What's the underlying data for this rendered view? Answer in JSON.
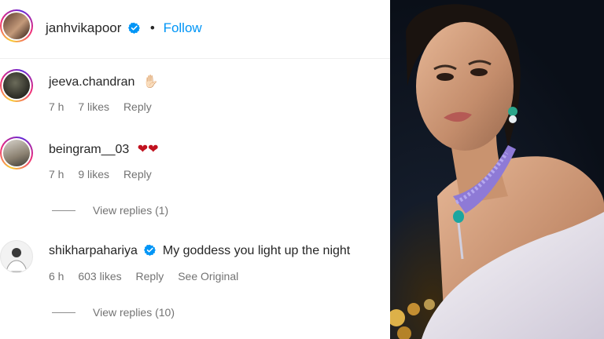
{
  "header": {
    "username": "janhvikapoor",
    "dot": "•",
    "follow_label": "Follow"
  },
  "comments": [
    {
      "username": "jeeva.chandran",
      "text": "✋🏻",
      "time": "7 h",
      "likes": "7 likes",
      "reply": "Reply"
    },
    {
      "username": "beingram__03",
      "text": "❤❤",
      "time": "7 h",
      "likes": "9 likes",
      "reply": "Reply",
      "view_replies": "View replies (1)"
    },
    {
      "username": "shikharpahariya",
      "text": "My goddess you light up the night",
      "time": "6 h",
      "likes": "603 likes",
      "reply": "Reply",
      "see_original": "See Original",
      "view_replies": "View replies (10)"
    }
  ],
  "colors": {
    "accent": "#0095f6",
    "verified": "#0095f6",
    "heart": "#c1121f"
  }
}
